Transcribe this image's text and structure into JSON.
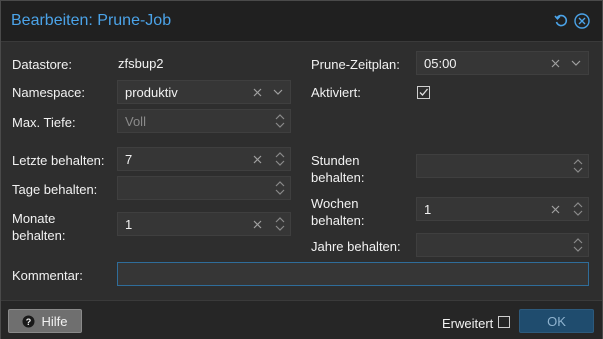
{
  "dialog": {
    "title": "Bearbeiten: Prune-Job"
  },
  "form": {
    "datastore_label": "Datastore:",
    "datastore_value": "zfsbup2",
    "namespace_label": "Namespace:",
    "namespace_value": "produktiv",
    "max_depth_label": "Max. Tiefe:",
    "max_depth_placeholder": "Voll",
    "keep_last_label": "Letzte behalten:",
    "keep_last_value": "7",
    "keep_daily_label": "Tage behalten:",
    "keep_daily_value": "",
    "keep_monthly_label_1": "Monate",
    "keep_monthly_label_2": "behalten:",
    "keep_monthly_value": "1",
    "schedule_label": "Prune-Zeitplan:",
    "schedule_value": "05:00",
    "enabled_label": "Aktiviert:",
    "enabled_checked": true,
    "keep_hourly_label_1": "Stunden",
    "keep_hourly_label_2": "behalten:",
    "keep_hourly_value": "",
    "keep_weekly_label_1": "Wochen",
    "keep_weekly_label_2": "behalten:",
    "keep_weekly_value": "1",
    "keep_yearly_label": "Jahre behalten:",
    "keep_yearly_value": "",
    "comment_label": "Kommentar:",
    "comment_value": ""
  },
  "footer": {
    "help_label": "Hilfe",
    "advanced_label": "Erweitert",
    "advanced_checked": false,
    "ok_label": "OK"
  },
  "colors": {
    "accent": "#4ba3e8",
    "ok_button": "#1f4c6e"
  },
  "icons": {
    "reset": "reset-icon",
    "close": "close-icon",
    "clear": "clear-icon",
    "dropdown": "chevron-down-icon",
    "spinner": "spinner-icon",
    "help": "question-icon"
  }
}
